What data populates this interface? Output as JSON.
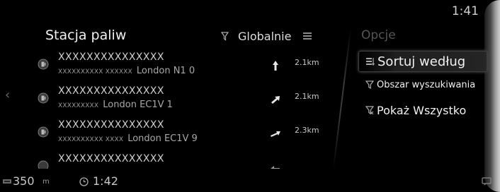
{
  "status": {
    "clock": "1:41"
  },
  "list": {
    "title": "Stacja paliw",
    "filter_label": "Globalnie",
    "rows": [
      {
        "title": "XXXXXXXXXXXXXXX",
        "sub_masked": "XXXXXXXXXX XXXXXX",
        "sub_location": "London N1 0",
        "distance": "2.1",
        "unit": "km",
        "direction": "up-arrow-icon"
      },
      {
        "title": "XXXXXXXXXXXXXXX",
        "sub_masked": "XXXXXXXXX",
        "sub_location": "London EC1V 1",
        "distance": "2.1",
        "unit": "km",
        "direction": "up-right-arrow-icon"
      },
      {
        "title": "XXXXXXXXXXXXXXX",
        "sub_masked": "XXXXXXXXXX XXXX",
        "sub_location": "London EC1V 9",
        "distance": "2.3",
        "unit": "km",
        "direction": "right-up-arrow-icon"
      },
      {
        "title": "XXXXXXXXXXXXXXX",
        "sub_masked": "",
        "sub_location": "",
        "distance": "",
        "unit": "",
        "direction": "left-arrow-icon"
      }
    ]
  },
  "options": {
    "title": "Opcje",
    "items": [
      {
        "label": "Sortuj według",
        "icon": "sort-list-icon",
        "active": true
      },
      {
        "label": "Obszar wyszukiwania",
        "icon": "filter-icon",
        "active": false
      },
      {
        "label": "Pokaż Wszystko",
        "icon": "filter-clear-icon",
        "active": false
      }
    ]
  },
  "bottom": {
    "scale_value": "350",
    "scale_unit": "m",
    "eta": "1:42"
  },
  "colors": {
    "background": "#000000",
    "text": "#f0f0f0",
    "muted": "#555555",
    "accent_icon": "#8a8a8a"
  }
}
